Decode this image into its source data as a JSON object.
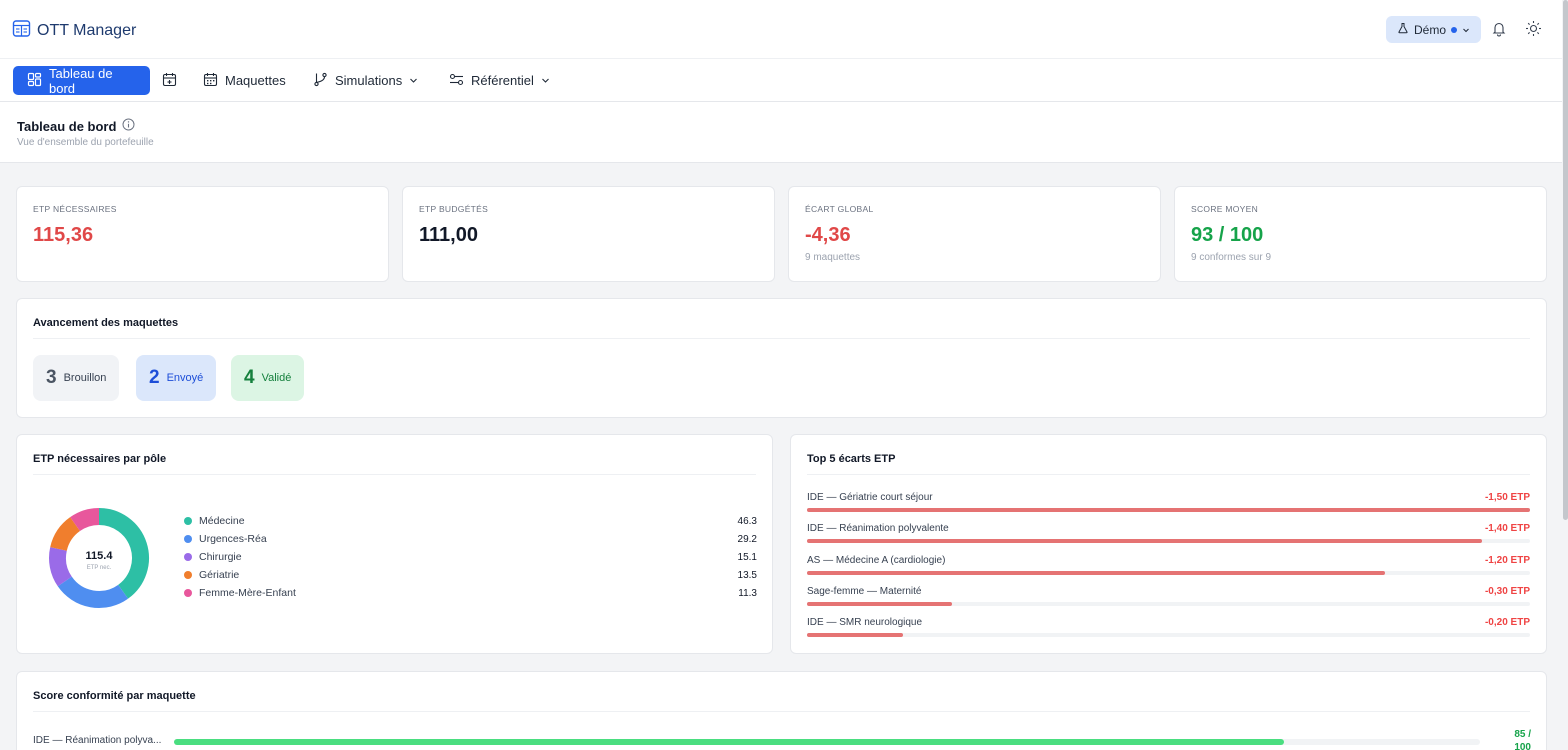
{
  "app": {
    "title": "OTT Manager"
  },
  "header": {
    "demo_label": "Démo"
  },
  "nav": {
    "dashboard": "Tableau de bord",
    "maquettes": "Maquettes",
    "simulations": "Simulations",
    "referentiel": "Référentiel"
  },
  "page": {
    "title": "Tableau de bord",
    "subtitle": "Vue d'ensemble du portefeuille"
  },
  "kpis": [
    {
      "label": "ETP NÉCESSAIRES",
      "value": "115,36",
      "color": "#e04848"
    },
    {
      "label": "ETP BUDGÉTÉS",
      "value": "111,00",
      "color": "#111827"
    },
    {
      "label": "ÉCART GLOBAL",
      "value": "-4,36",
      "sub": "9 maquettes",
      "color": "#e04848"
    },
    {
      "label": "SCORE MOYEN",
      "value": "93 / 100",
      "sub": "9 conformes sur 9",
      "color": "#16a34a"
    }
  ],
  "progress": {
    "title": "Avancement des maquettes",
    "items": [
      {
        "count": "3",
        "label": "Brouillon"
      },
      {
        "count": "2",
        "label": "Envoyé"
      },
      {
        "count": "4",
        "label": "Validé"
      }
    ]
  },
  "poles": {
    "title": "ETP nécessaires par pôle",
    "total": "115.4",
    "total_label": "ETP nec.",
    "items": [
      {
        "name": "Médecine",
        "value": "46.3",
        "color": "#2dbfa5"
      },
      {
        "name": "Urgences-Réa",
        "value": "29.2",
        "color": "#4f8ef0"
      },
      {
        "name": "Chirurgie",
        "value": "15.1",
        "color": "#9a6be8"
      },
      {
        "name": "Gériatrie",
        "value": "13.5",
        "color": "#f07e2d"
      },
      {
        "name": "Femme-Mère-Enfant",
        "value": "11.3",
        "color": "#e8579c"
      }
    ]
  },
  "top5": {
    "title": "Top 5 écarts ETP",
    "items": [
      {
        "name": "IDE — Gériatrie court séjour",
        "value": "-1,50 ETP",
        "num": -1.5
      },
      {
        "name": "IDE — Réanimation polyvalente",
        "value": "-1,40 ETP",
        "num": -1.4
      },
      {
        "name": "AS — Médecine A (cardiologie)",
        "value": "-1,20 ETP",
        "num": -1.2
      },
      {
        "name": "Sage-femme — Maternité",
        "value": "-0,30 ETP",
        "num": -0.3
      },
      {
        "name": "IDE — SMR neurologique",
        "value": "-0,20 ETP",
        "num": -0.2
      }
    ]
  },
  "scores": {
    "title": "Score conformité par maquette",
    "items": [
      {
        "name": "IDE — Réanimation polyva...",
        "value_line1": "85 /",
        "value_line2": "100",
        "score": 85
      }
    ]
  }
}
